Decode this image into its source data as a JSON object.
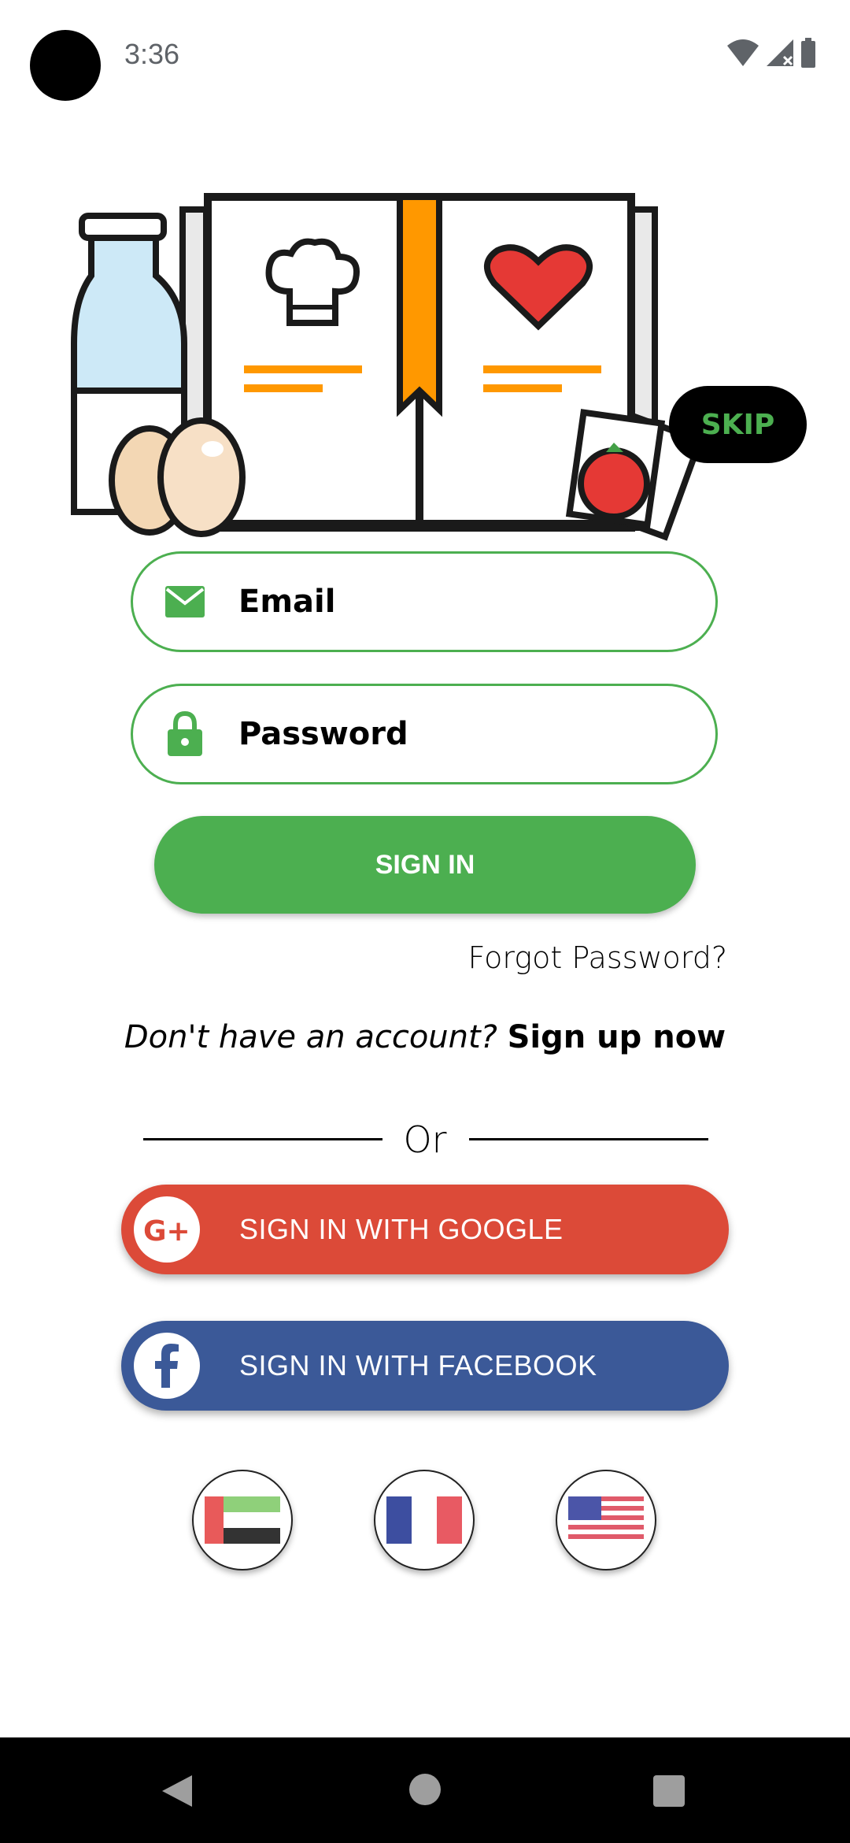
{
  "status_bar": {
    "time": "3:36",
    "icons": [
      "wifi-icon",
      "signal-icon",
      "battery-icon"
    ]
  },
  "header": {
    "skip_label": "SKIP"
  },
  "form": {
    "email_placeholder": "Email",
    "password_placeholder": "Password",
    "signin_label": "SIGN IN",
    "forgot_label": "Forgot Password?",
    "signup_prompt": "Don't have an account?",
    "signup_link": "Sign up now",
    "or_label": "Or"
  },
  "social": {
    "google_label": "SIGN IN WITH GOOGLE",
    "facebook_label": "SIGN IN WITH FACEBOOK"
  },
  "languages": [
    "uae-flag-icon",
    "france-flag-icon",
    "usa-flag-icon"
  ],
  "colors": {
    "accent": "#4caf50",
    "google": "#dc4a38",
    "facebook": "#3b5998",
    "book_ribbon": "#ff9800"
  },
  "nav": [
    "back-icon",
    "home-icon",
    "recents-icon"
  ]
}
